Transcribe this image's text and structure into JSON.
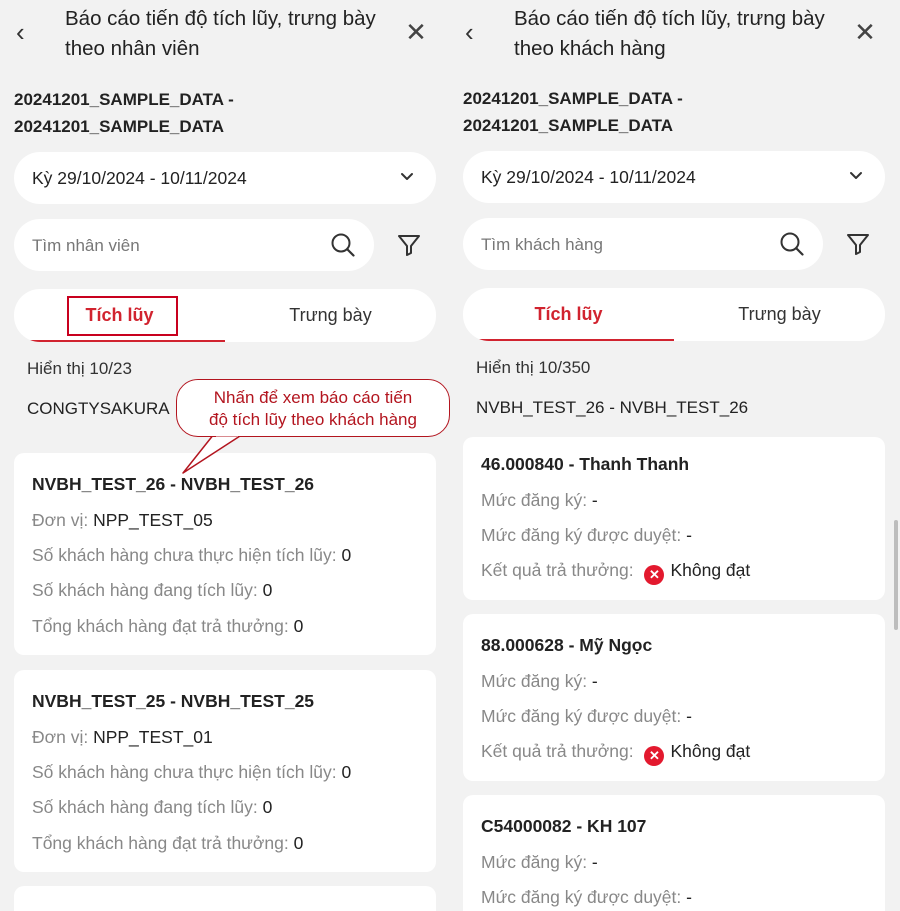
{
  "left": {
    "title": "Báo cáo tiến độ tích lũy, trưng bày theo nhân viên",
    "dataset_line1": "20241201_SAMPLE_DATA -",
    "dataset_line2": "20241201_SAMPLE_DATA",
    "period": "Kỳ 29/10/2024 - 10/11/2024",
    "search_placeholder": "Tìm nhân viên",
    "tabs": [
      "Tích lũy",
      "Trưng bày"
    ],
    "count": "Hiển thị 10/23",
    "group": "CONGTYSAKURA",
    "cards": [
      {
        "name": "NVBH_TEST_26 - NVBH_TEST_26",
        "rows": [
          {
            "label": "Đơn vị: ",
            "value": "NPP_TEST_05"
          },
          {
            "label": "Số khách hàng chưa thực hiện tích lũy: ",
            "value": "0"
          },
          {
            "label": "Số khách hàng đang tích lũy: ",
            "value": "0"
          },
          {
            "label": "Tổng khách hàng đạt trả thưởng: ",
            "value": "0"
          }
        ]
      },
      {
        "name": "NVBH_TEST_25 - NVBH_TEST_25",
        "rows": [
          {
            "label": "Đơn vị: ",
            "value": "NPP_TEST_01"
          },
          {
            "label": "Số khách hàng chưa thực hiện tích lũy: ",
            "value": "0"
          },
          {
            "label": "Số khách hàng đang tích lũy: ",
            "value": "0"
          },
          {
            "label": "Tổng khách hàng đạt trả thưởng: ",
            "value": "0"
          }
        ]
      }
    ]
  },
  "right": {
    "title": "Báo cáo tiến độ tích lũy, trưng bày theo khách hàng",
    "dataset_line1": "20241201_SAMPLE_DATA -",
    "dataset_line2": "20241201_SAMPLE_DATA",
    "period": "Kỳ 29/10/2024 - 10/11/2024",
    "search_placeholder": "Tìm khách hàng",
    "tabs": [
      "Tích lũy",
      "Trưng bày"
    ],
    "count": "Hiển thị 10/350",
    "group": "NVBH_TEST_26 - NVBH_TEST_26",
    "cards": [
      {
        "name": "46.000840 - Thanh Thanh",
        "rows": [
          {
            "label": "Mức đăng ký: ",
            "value": "-"
          },
          {
            "label": "Mức đăng ký được duyệt: ",
            "value": "-"
          },
          {
            "label": "Kết quả trả thưởng: ",
            "value": "Không đạt"
          }
        ]
      },
      {
        "name": "88.000628 - Mỹ Ngọc",
        "rows": [
          {
            "label": "Mức đăng ký: ",
            "value": "-"
          },
          {
            "label": "Mức đăng ký được duyệt: ",
            "value": "-"
          },
          {
            "label": "Kết quả trả thưởng: ",
            "value": "Không đạt"
          }
        ]
      },
      {
        "name": "C54000082 - KH 107",
        "rows": [
          {
            "label": "Mức đăng ký: ",
            "value": "-"
          },
          {
            "label": "Mức đăng ký được duyệt: ",
            "value": "-"
          }
        ]
      }
    ]
  },
  "callout": {
    "line1": "Nhấn để xem báo cáo tiến",
    "line2": "độ tích lũy theo khách hàng"
  },
  "colors": {
    "accent": "#d1232f",
    "annotation": "#b3151f",
    "background": "#f2f2f2",
    "fail_badge": "#e3192e"
  },
  "icons": [
    "back-icon",
    "close-icon",
    "chevron-down-icon",
    "search-icon",
    "filter-icon",
    "close-circle-icon"
  ]
}
